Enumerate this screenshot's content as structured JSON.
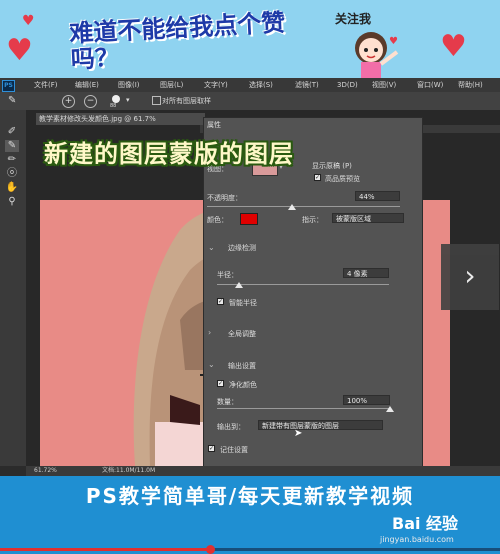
{
  "banner": {
    "title": "难道不能给我点个赞吗？",
    "follow_label": "关注我",
    "colors": {
      "background": "#8fd3f0",
      "heart": "#e53b4b",
      "title": "#1e3aa8"
    }
  },
  "menubar": {
    "app_icon": "PS",
    "items": [
      "文件(F)",
      "编辑(E)",
      "图像(I)",
      "图层(L)",
      "文字(Y)",
      "选择(S)",
      "滤镜(T)",
      "3D(D)",
      "视图(V)",
      "窗口(W)",
      "帮助(H)"
    ]
  },
  "options_bar": {
    "brush_size": "88",
    "sample_all_layers_label": "对所有图层取样"
  },
  "document": {
    "tab_title": "教学素材修改头发颜色.jpg @ 61.7%"
  },
  "overlay": {
    "title": "新建的图层蒙版的图层"
  },
  "dialog": {
    "title": "属性",
    "view_label": "视图：",
    "show_original_label": "显示原稿 (P)",
    "high_quality_preview_label": "高品质预览",
    "opacity_label": "不透明度：",
    "opacity_value": "44%",
    "color_label": "颜色：",
    "color_swatch": "#e00000",
    "indicate_label": "指示：",
    "indicate_value": "被蒙版区域",
    "edge_detection_label": "边缘检测",
    "radius_label": "半径：",
    "radius_value": "4 像素",
    "smart_radius_label": "智能半径",
    "global_refine_label": "全局调整",
    "output_settings_label": "输出设置",
    "decontaminate_label": "净化颜色",
    "amount_label": "数量：",
    "amount_value": "100%",
    "output_to_label": "输出到：",
    "output_to_value": "新建带有图层蒙版的图层",
    "remember_label": "记住设置",
    "levels": {
      "opacity": 0.44,
      "radius": 0.13,
      "amount": 1.0
    }
  },
  "statusbar": {
    "zoom": "61.72%",
    "doc_info": "文档:11.0M/11.0M"
  },
  "bottom_banner": {
    "text": "PS教学简单哥/每天更新教学视频",
    "watermark_brand": "Bai 经验",
    "watermark_site": "jingyan.baidu.com",
    "progress": 0.42,
    "colors": {
      "background": "#1f8fd2",
      "progress": "#e03030"
    }
  }
}
